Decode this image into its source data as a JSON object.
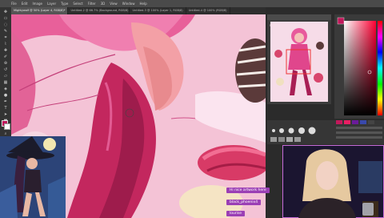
{
  "menu": {
    "items": [
      "File",
      "Edit",
      "Image",
      "Layer",
      "Type",
      "Select",
      "Filter",
      "3D",
      "View",
      "Window",
      "Help"
    ]
  },
  "tabs": [
    {
      "label": "Mightywolf @ 50% (Layer 4, RGB/8)*",
      "active": true
    },
    {
      "label": "Untitled-2 @ 66.7% (Background, RGB/8)",
      "active": false
    },
    {
      "label": "Untitled-3 @ 100% (Layer 1, RGB/8)",
      "active": false
    },
    {
      "label": "Untitled-4 @ 100% (RGB/8)",
      "active": false
    }
  ],
  "tools": [
    "move",
    "marquee",
    "lasso",
    "quick-select",
    "crop",
    "eyedropper",
    "healing",
    "brush",
    "clone",
    "history",
    "eraser",
    "gradient",
    "blur",
    "dodge",
    "pen",
    "type",
    "path-select",
    "shape",
    "hand",
    "zoom"
  ],
  "navigator": {
    "title": "Navigator"
  },
  "colors": {
    "foreground": "#c2185b",
    "background": "#ffffff",
    "accent": "#9b3fb5"
  },
  "chat": {
    "line1": "Hi nice artwork here",
    "line2": "black_phoenix4",
    "line3": "lourise"
  }
}
